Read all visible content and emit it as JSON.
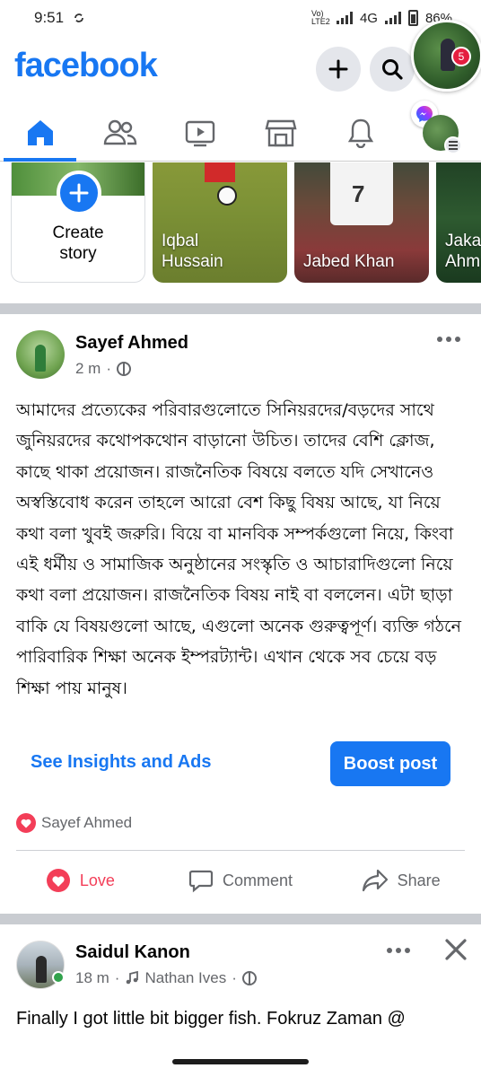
{
  "status_bar": {
    "time": "9:51",
    "network": "4G",
    "carrier_tag": "Vo) LTE2",
    "battery": "86%"
  },
  "header": {
    "logo": "facebook",
    "notification_count": "5"
  },
  "stories": {
    "create_label_line1": "Create",
    "create_label_line2": "story",
    "items": [
      {
        "name_line1": "Iqbal",
        "name_line2": "Hussain"
      },
      {
        "name_line1": "Jabed Khan",
        "name_line2": ""
      },
      {
        "name_line1": "Jaka",
        "name_line2": "Ahm"
      }
    ],
    "jersey_number": "7"
  },
  "post1": {
    "author": "Sayef Ahmed",
    "time": "2 m",
    "text": "আমাদের প্রত্যেকের  পরিবারগুলোতে সিনিয়রদের/বড়দের সাথে জুনিয়রদের কথোপকথোন বাড়ানো উচিত। তাদের বেশি ক্লোজ, কাছে থাকা প্রয়োজন। রাজনৈতিক বিষয়ে বলতে যদি সেখানেও অস্বস্তিবোধ করেন তাহলে আরো বেশ কিছু বিষয় আছে, যা নিয়ে কথা বলা খুবই জরুরি। বিয়ে বা মানবিক সম্পর্কগুলো নিয়ে, কিংবা এই ধর্মীয় ও সামাজিক অনুষ্ঠানের সংস্কৃতি ও আচারাদিগুলো নিয়ে কথা বলা প্রয়োজন। রাজনৈতিক বিষয় নাই বা বললেন। এটা ছাড়া বাকি যে বিষয়গুলো আছে, এগুলো অনেক গুরুত্বপূর্ণ। ব্যক্তি গঠনে পারিবারিক শিক্ষা অনেক ইম্পরট্যান্ট।  এখান থেকে সব চেয়ে বড় শিক্ষা পায় মানুষ।",
    "insights_label": "See Insights and Ads",
    "boost_label": "Boost post",
    "reaction_name": "Sayef Ahmed",
    "actions": {
      "love": "Love",
      "comment": "Comment",
      "share": "Share"
    }
  },
  "post2": {
    "author": "Saidul Kanon",
    "time": "18 m",
    "music": "Nathan Ives",
    "text": "Finally I got little bit bigger fish. Fokruz Zaman @"
  },
  "colors": {
    "brand": "#1877f2",
    "love": "#f33e58",
    "badge": "#e41e3f",
    "muted": "#65676b"
  }
}
